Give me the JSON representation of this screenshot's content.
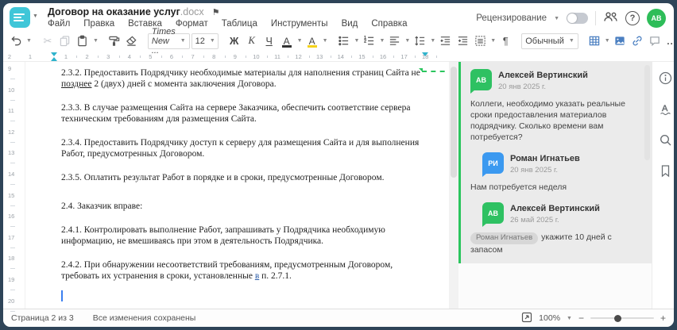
{
  "window": {
    "title": "Договор на оказание услуг",
    "title_ext": ".docx"
  },
  "menu": {
    "items": [
      "Файл",
      "Правка",
      "Вставка",
      "Формат",
      "Таблица",
      "Инструменты",
      "Вид",
      "Справка"
    ]
  },
  "header_right": {
    "review_label": "Рецензирование",
    "review_toggle": "off",
    "avatar_initials": "АВ",
    "help_label": "?"
  },
  "toolbar": {
    "font_name": "Times New ...",
    "font_size": "12",
    "bold": "Ж",
    "italic": "К",
    "underline": "Ч",
    "font_color_letter": "А",
    "highlight_letter": "А",
    "paragraph_mark": "¶",
    "style_name": "Обычный",
    "more_label": "..."
  },
  "ruler": {
    "h_left_numbers": [
      "2",
      "1"
    ],
    "h_numbers": [
      "1",
      "2",
      "3",
      "4",
      "5",
      "6",
      "7",
      "8",
      "9",
      "10",
      "11",
      "12",
      "13",
      "14",
      "15",
      "16",
      "17",
      "18"
    ],
    "v_numbers": [
      "9",
      "10",
      "11",
      "12",
      "13",
      "14",
      "15",
      "16",
      "17",
      "18",
      "19",
      "20"
    ]
  },
  "document": {
    "p1": {
      "pre": "2.3.2. Предоставить Подрядчику необходимые материалы для наполнения страниц Сайта не ",
      "ins": "позднее",
      "post": " 2 (двух) дней с момента заключения Договора."
    },
    "p2": "2.3.3. В случае размещения Сайта на сервере Заказчика, обеспечить соответствие сервера техническим требованиям для размещения Сайта.",
    "p3": "2.3.4. Предоставить Подрядчику доступ к серверу для размещения Сайта и для выполнения Работ, предусмотренных Договором.",
    "p4": "2.3.5. Оплатить результат Работ в порядке и в сроки, предусмотренные Договором.",
    "p5": "2.4. Заказчик вправе:",
    "p6": "2.4.1. Контролировать выполнение Работ, запрашивать у Подрядчика необходимую информацию, не вмешиваясь при этом в деятельность Подрядчика.",
    "p7": {
      "pre": "2.4.2. При обнаружении несоответствий требованиям, предусмотренным Договором, требовать их устранения в сроки, установленные ",
      "ins": "в",
      "post": " п. 2.7.1."
    }
  },
  "comments": [
    {
      "initials": "АВ",
      "name": "Алексей Вертинский",
      "date": "20 янв 2025 г.",
      "text": "Коллеги, необходимо указать реальные сроки предоставления материалов подрядчику. Сколько времени вам потребуется?",
      "avatar_color": "#2ec162"
    },
    {
      "initials": "РИ",
      "name": "Роман Игнатьев",
      "date": "20 янв 2025 г.",
      "text": "Нам потребуется неделя",
      "avatar_color": "#3b99f0"
    },
    {
      "initials": "АВ",
      "name": "Алексей Вертинский",
      "date": "26 май 2025 г.",
      "mention": "Роман Игнатьев",
      "text": "укажите 10 дней с запасом",
      "avatar_color": "#2ec162"
    }
  ],
  "status_bar": {
    "page_label": "Страница 2 из 3",
    "saved_label": "Все изменения сохранены",
    "zoom_level": "100%",
    "zoom_minus": "−",
    "zoom_plus": "+"
  },
  "colors": {
    "logo_teal": "#3fc6d8",
    "review_green": "#2bc55e",
    "avatar_green": "#2ebd59",
    "avatar_blue": "#3b99f0",
    "toolbar_blue": "#4a7fc1",
    "highlight_yellow": "#f4d21a",
    "thread_bg": "#ebebeb"
  },
  "icons": [
    "logo",
    "flag",
    "people",
    "help",
    "avatar",
    "undo",
    "cut",
    "copy",
    "paste",
    "format-painter",
    "eraser",
    "bold",
    "italic",
    "underline",
    "font-color",
    "highlight",
    "bullet-list",
    "numbered-list",
    "align",
    "line-spacing",
    "outdent",
    "indent",
    "paragraph-borders",
    "pilcrow",
    "table",
    "image",
    "link",
    "comment",
    "more",
    "info",
    "spellcheck",
    "search",
    "bookmark",
    "fit-page",
    "zoom-slider"
  ]
}
